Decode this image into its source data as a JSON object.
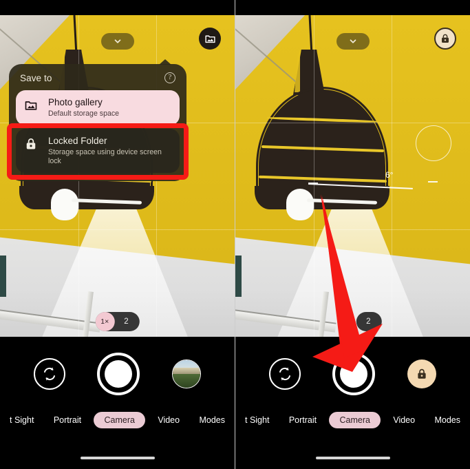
{
  "meta": {
    "app": "Google Camera",
    "accent_pink": "#ebcbd4",
    "accent_light_pink": "#f8dbe0",
    "highlight_red": "#f51b16",
    "sheet_bg": "#2e291a",
    "lock_chip_bg": "#f4d9b2"
  },
  "left_panel": {
    "top_bar": {
      "chevron_icon": "chevron-down-icon",
      "gallery_icon": "photo-gallery-icon"
    },
    "sheet": {
      "title": "Save to",
      "help_icon": "help-circle-icon",
      "options": [
        {
          "icon": "photo-gallery-icon",
          "name": "Photo gallery",
          "subtitle": "Default storage space",
          "selected": false,
          "highlighted": false
        },
        {
          "icon": "lock-icon",
          "name": "Locked Folder",
          "subtitle": "Storage space using device screen lock",
          "selected": false,
          "highlighted": true
        }
      ]
    },
    "zoom": {
      "active_label": "1×",
      "other_label": "2"
    },
    "bottom_bar": {
      "flip_icon": "camera-flip-icon",
      "shutter_icon": "shutter-button",
      "thumbnail_icon": "photo-thumbnail",
      "modes": [
        {
          "label": "t Sight",
          "active": false
        },
        {
          "label": "Portrait",
          "active": false
        },
        {
          "label": "Camera",
          "active": true
        },
        {
          "label": "Video",
          "active": false
        },
        {
          "label": "Modes",
          "active": false
        }
      ]
    }
  },
  "right_panel": {
    "top_bar": {
      "chevron_icon": "chevron-down-icon",
      "lock_icon": "lock-icon"
    },
    "level_indicator": {
      "angle_label": "6°"
    },
    "focus_ring": "focus-ring",
    "zoom": {
      "other_label": "2"
    },
    "annotation": {
      "arrow_icon": "red-arrow-icon",
      "points_to": "shutter-button"
    },
    "bottom_bar": {
      "flip_icon": "camera-flip-icon",
      "shutter_icon": "shutter-button",
      "thumbnail_icon": "locked-folder-chip",
      "modes": [
        {
          "label": "t Sight",
          "active": false
        },
        {
          "label": "Portrait",
          "active": false
        },
        {
          "label": "Camera",
          "active": true
        },
        {
          "label": "Video",
          "active": false
        },
        {
          "label": "Modes",
          "active": false
        }
      ]
    }
  }
}
